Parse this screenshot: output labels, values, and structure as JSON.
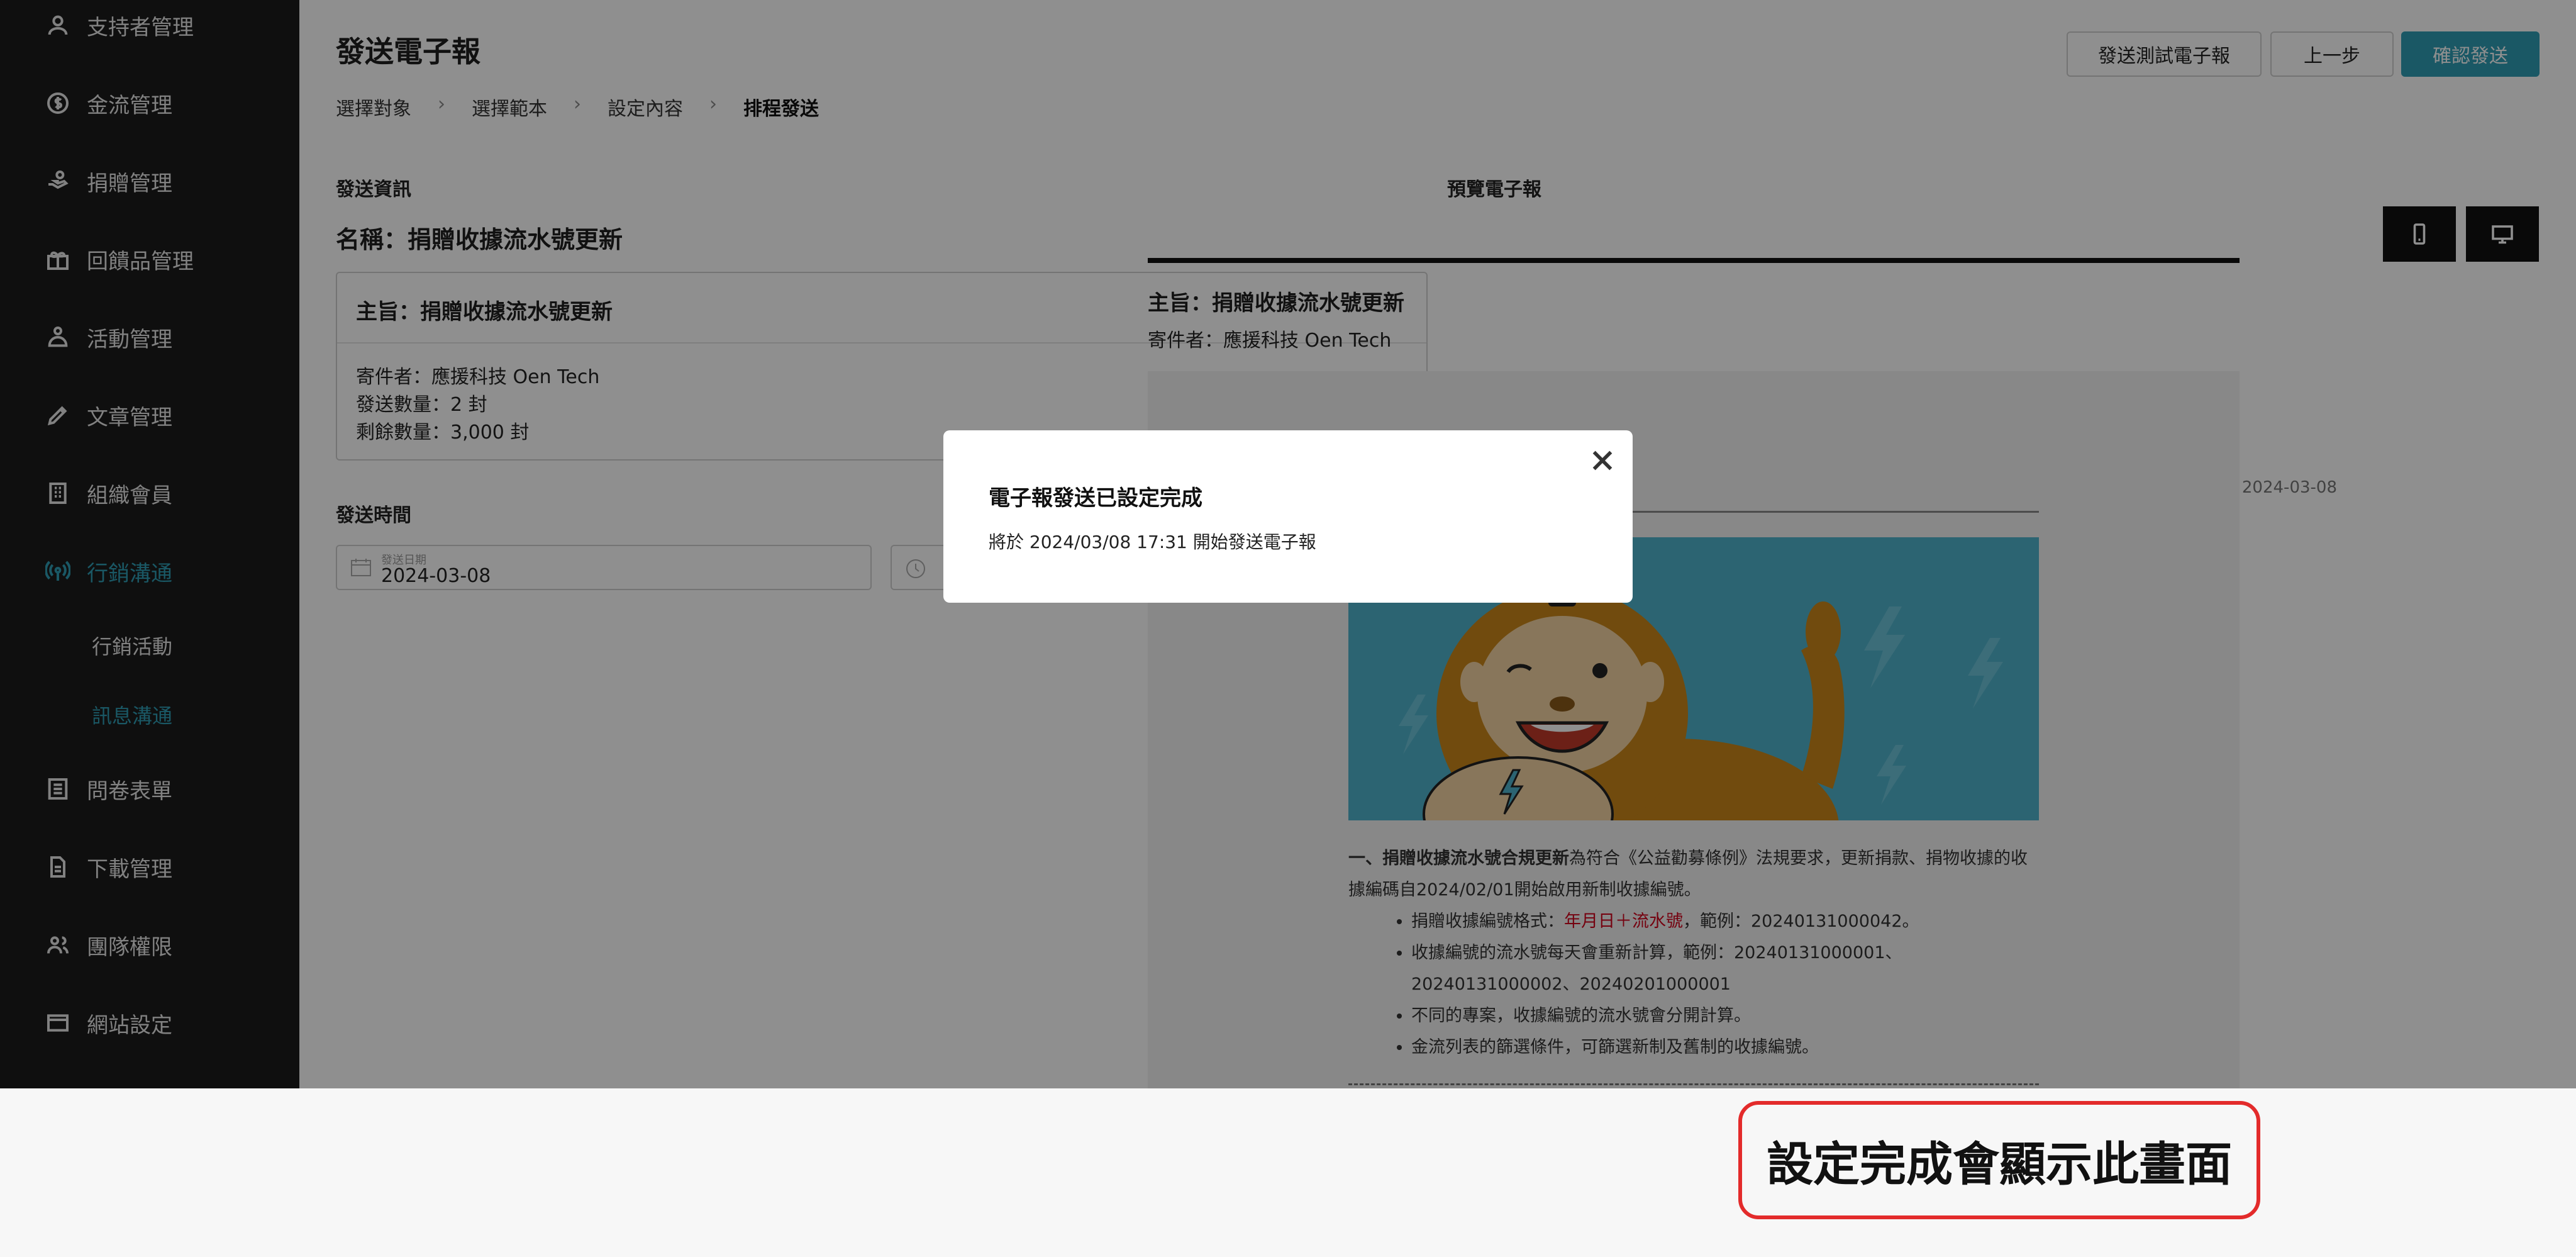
{
  "sidebar": {
    "items": [
      {
        "label": "支持者管理",
        "icon": "user-icon"
      },
      {
        "label": "金流管理",
        "icon": "dollar-coin-icon"
      },
      {
        "label": "捐贈管理",
        "icon": "hand-donate-icon"
      },
      {
        "label": "回饋品管理",
        "icon": "gift-icon"
      },
      {
        "label": "活動管理",
        "icon": "activity-icon"
      },
      {
        "label": "文章管理",
        "icon": "pen-icon"
      },
      {
        "label": "組織會員",
        "icon": "building-icon"
      },
      {
        "label": "行銷溝通",
        "icon": "broadcast-icon"
      },
      {
        "label": "問卷表單",
        "icon": "list-form-icon"
      },
      {
        "label": "下載管理",
        "icon": "document-icon"
      },
      {
        "label": "團隊權限",
        "icon": "team-icon"
      },
      {
        "label": "網站設定",
        "icon": "window-icon"
      }
    ],
    "subitems": [
      {
        "label": "行銷活動"
      },
      {
        "label": "訊息溝通"
      }
    ],
    "active_color": "#2f9db5"
  },
  "header": {
    "title": "發送電子報",
    "steps": [
      "選擇對象",
      "選擇範本",
      "設定內容",
      "排程發送"
    ],
    "buttons": {
      "test": "發送測試電子報",
      "prev": "上一步",
      "confirm": "確認發送"
    }
  },
  "send_info": {
    "section": "發送資訊",
    "name": "名稱：捐贈收據流水號更新",
    "subject": "主旨：捐贈收據流水號更新",
    "sender": "寄件者：應援科技 Oen Tech",
    "sent_count": "發送數量：2 封",
    "remaining": "剩餘數量：3,000 封"
  },
  "send_time": {
    "section": "發送時間",
    "date_label": "發送日期",
    "date_value": "2024-03-08"
  },
  "preview": {
    "section": "預覽電子報",
    "subject": "主旨：捐贈收據流水號更新",
    "sender": "寄件者：應援科技 Oen Tech",
    "date": "2024-03-08",
    "intro_bold": "一、捐贈收據流水號合規更新",
    "intro_rest": "為符合《公益勸募條例》法規要求，更新捐款、捐物收據的收據編碼自2024/02/01開始啟用新制收據編號。",
    "bullet1_pre": "捐贈收據編號格式：",
    "bullet1_red": "年月日＋流水號",
    "bullet1_post": "，範例：20240131000042。",
    "bullet2": "收據編號的流水號每天會重新計算，範例：20240131000001、20240131000002、20240201000001",
    "bullet3": "不同的專案，收據編號的流水號會分開計算。",
    "bullet4": "金流列表的篩選條件，可篩選新制及舊制的收據編號。"
  },
  "modal": {
    "title": "電子報發送已設定完成",
    "body": "將於 2024/03/08 17:31 開始發送電子報"
  },
  "annotation": {
    "text": "設定完成會顯示此畫面",
    "border_color": "#e32b2b"
  }
}
